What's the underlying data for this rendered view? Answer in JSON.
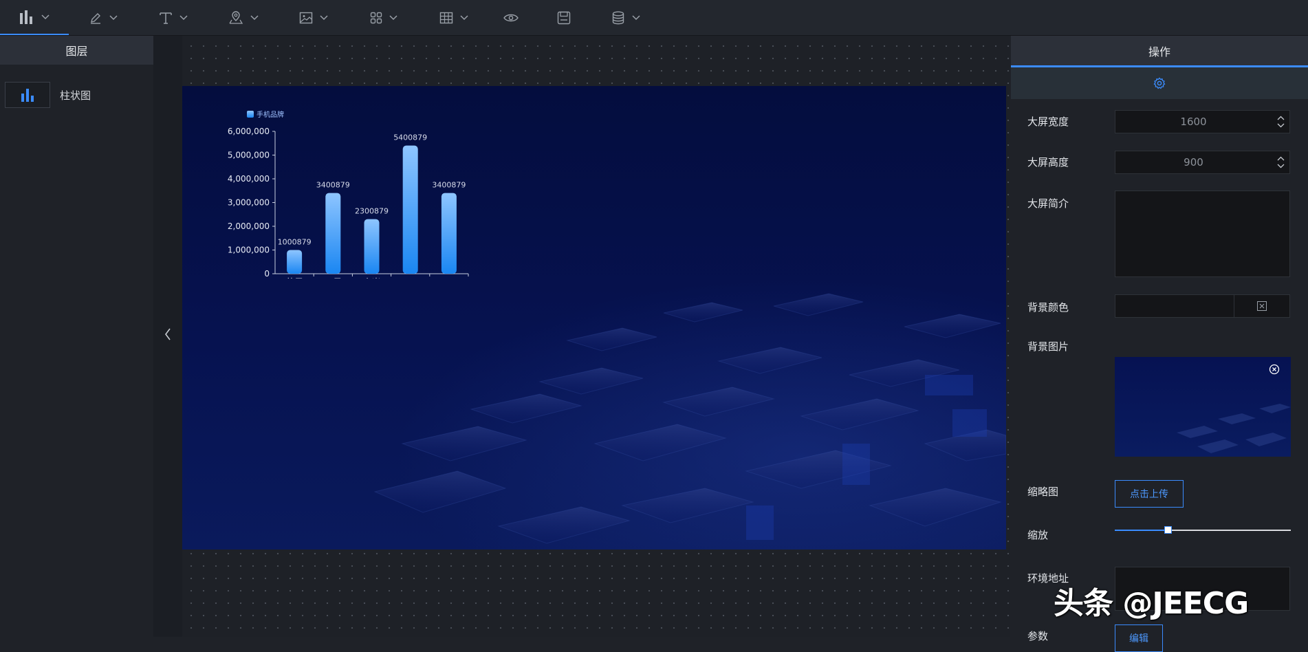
{
  "toolbar": {
    "tools": [
      {
        "name": "bar-chart-tool",
        "icon": "bar-chart-icon",
        "dropdown": true,
        "active": true
      },
      {
        "name": "pen-tool",
        "icon": "pen-icon",
        "dropdown": true
      },
      {
        "name": "text-tool",
        "icon": "text-icon",
        "dropdown": true
      },
      {
        "name": "map-tool",
        "icon": "map-pin-icon",
        "dropdown": true
      },
      {
        "name": "image-tool",
        "icon": "image-icon",
        "dropdown": true
      },
      {
        "name": "widget-tool",
        "icon": "grid-widget-icon",
        "dropdown": true
      },
      {
        "name": "table-tool",
        "icon": "table-icon",
        "dropdown": true
      },
      {
        "name": "preview-tool",
        "icon": "eye-icon",
        "dropdown": false
      },
      {
        "name": "save-tool",
        "icon": "save-icon",
        "dropdown": false
      },
      {
        "name": "datasource-tool",
        "icon": "database-icon",
        "dropdown": true
      }
    ]
  },
  "layers": {
    "title": "图层",
    "items": [
      {
        "label": "柱状图",
        "icon": "bar-chart-icon"
      }
    ]
  },
  "operations": {
    "title": "操作",
    "tab_icon": "gear-icon",
    "width_label": "大屏宽度",
    "width_value": "1600",
    "height_label": "大屏高度",
    "height_value": "900",
    "desc_label": "大屏简介",
    "desc_value": "",
    "bg_color_label": "背景颜色",
    "bg_image_label": "背景图片",
    "thumbnail_label": "缩略图",
    "upload_label": "点击上传",
    "zoom_label": "缩放",
    "zoom_fraction": 0.3,
    "env_label": "环境地址",
    "env_value": "",
    "params_label": "参数",
    "edit_label": "编辑"
  },
  "watermark": "头条 @JEECG",
  "colors": {
    "accent": "#3b8cff",
    "bar_top": "#8ec5ff",
    "bar_bottom": "#1a86f2",
    "screen_bg": "#061250"
  },
  "chart_data": {
    "type": "bar",
    "legend": [
      "手机品牌"
    ],
    "categories": [
      "苹果",
      "三星",
      "小米",
      "oppo",
      "vivo"
    ],
    "series": [
      {
        "name": "手机品牌",
        "values": [
          1000879,
          3400879,
          2300879,
          5400879,
          3400879
        ]
      }
    ],
    "yticks": [
      "0",
      "1,000,000",
      "2,000,000",
      "3,000,000",
      "4,000,000",
      "5,000,000",
      "6,000,000"
    ],
    "ylim": [
      0,
      6000000
    ],
    "show_labels": true,
    "grid": false,
    "legend_position": "top-left"
  }
}
